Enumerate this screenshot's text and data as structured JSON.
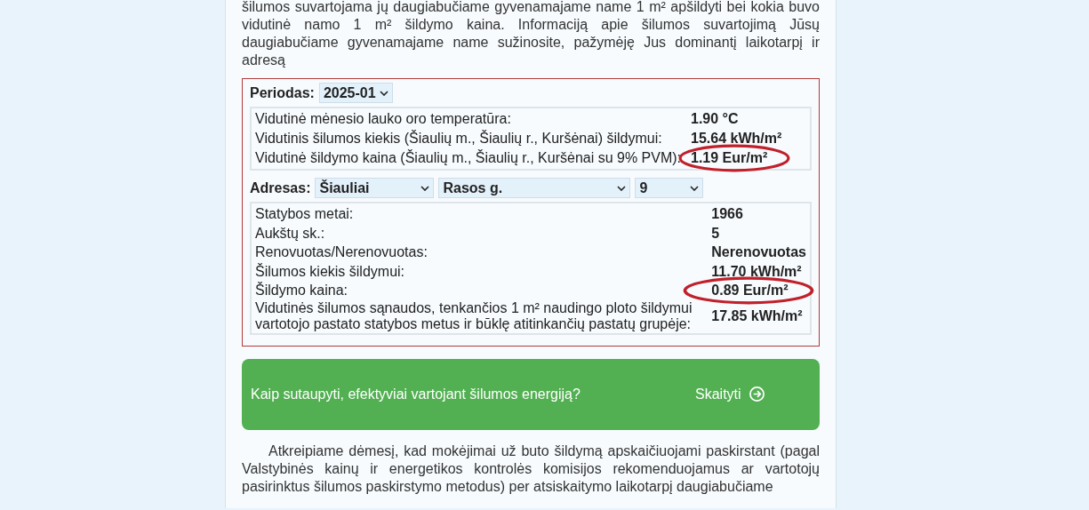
{
  "intro": "šilumos suvartojama jų daugiabučiame gyvenamajame name 1 m² apšildyti bei kokia buvo vidutinė namo 1 m² šildymo kaina. Informaciją apie šilumos suvartojimą Jūsų daugiabučiame gyvenamajame name sužinosite, pažymėję Jus dominantį laikotarpį ir adresą",
  "period": {
    "label": "Periodas:",
    "value": "2025-01"
  },
  "summary": [
    {
      "label": "Vidutinė mėnesio lauko oro temperatūra:",
      "value": "1.90 °C",
      "circled": false
    },
    {
      "label": "Vidutinis šilumos kiekis (Šiaulių m., Šiaulių r., Kuršėnai) šildymui:",
      "value": "15.64 kWh/m²",
      "circled": false
    },
    {
      "label": "Vidutinė šildymo kaina (Šiaulių m., Šiaulių r., Kuršėnai su 9% PVM):",
      "value": "1.19 Eur/m²",
      "circled": true
    }
  ],
  "address": {
    "label": "Adresas:",
    "city": "Šiauliai",
    "street": "Rasos g.",
    "number": "9"
  },
  "building": [
    {
      "label": "Statybos metai:",
      "value": "1966",
      "circled": false
    },
    {
      "label": "Aukštų sk.:",
      "value": "5",
      "circled": false
    },
    {
      "label": "Renovuotas/Nerenovuotas:",
      "value": "Nerenovuotas",
      "circled": false
    },
    {
      "label": "Šilumos kiekis šildymui:",
      "value": "11.70 kWh/m²",
      "circled": false
    },
    {
      "label": "Šildymo kaina:",
      "value": "0.89 Eur/m²",
      "circled": true
    },
    {
      "label": "Vidutinės šilumos sąnaudos, tenkančios 1 m² naudingo ploto šildymui vartotojo pastato statybos metus ir būklę atitinkančių pastatų grupėje:",
      "value": "17.85 kWh/m²",
      "circled": false
    }
  ],
  "banner": {
    "text": "Kaip sutaupyti, efektyviai vartojant šilumos energiją?",
    "link": "Skaityti"
  },
  "note": "Atkreipiame dėmesį, kad mokėjimai už buto šildymą apskaičiuojami paskirstant (pagal Valstybinės kainų ir energetikos kontrolės komisijos rekomenduojamus ar vartotojų pasirinktus šilumos paskirstymo metodus) per atsiskaitymo laikotarpį daugiabučiame"
}
